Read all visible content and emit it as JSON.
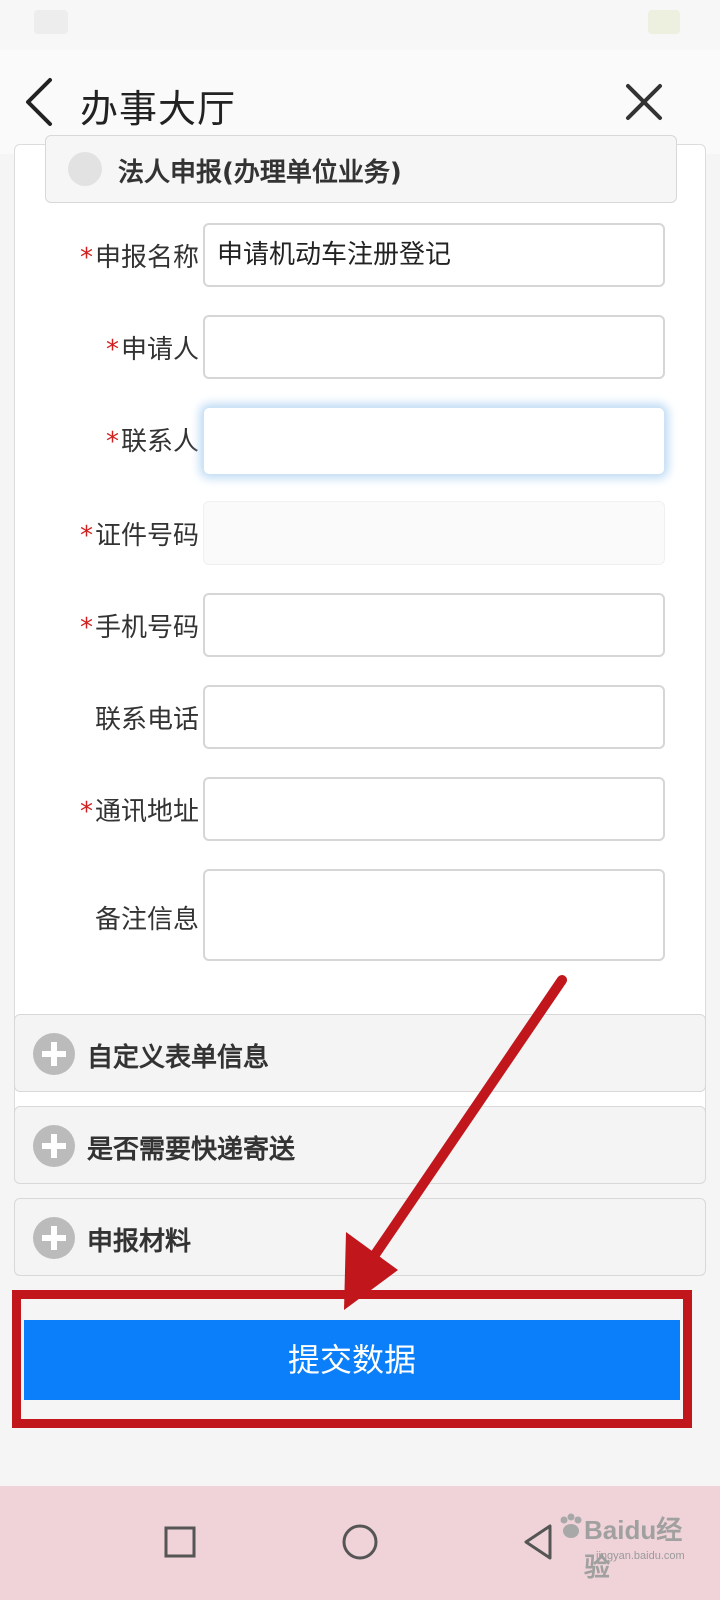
{
  "header": {
    "title": "办事大厅"
  },
  "form": {
    "applicant_type_option": "法人申报(办理单位业务)",
    "required_mark": "*",
    "fields": [
      {
        "label": "申报名称",
        "value": "申请机动车注册登记",
        "required": true
      },
      {
        "label": "申请人",
        "value": "",
        "required": true
      },
      {
        "label": "联系人",
        "value": "",
        "required": true
      },
      {
        "label": "证件号码",
        "value": "",
        "required": true
      },
      {
        "label": "手机号码",
        "value": "",
        "required": true
      },
      {
        "label": "联系电话",
        "value": "",
        "required": false
      },
      {
        "label": "通讯地址",
        "value": "",
        "required": true
      },
      {
        "label": "备注信息",
        "value": "",
        "required": false
      }
    ]
  },
  "sections": [
    {
      "label": "自定义表单信息"
    },
    {
      "label": "是否需要快递寄送"
    },
    {
      "label": "申报材料"
    }
  ],
  "submit": {
    "label": "提交数据"
  },
  "annotation": {
    "color": "#c0161c"
  },
  "watermark": {
    "main": "Baidu经验",
    "sub": "jingyan.baidu.com"
  },
  "colors": {
    "primary_button": "#0b7ef9",
    "required_star": "#d12020",
    "nav_bar": "#efd3d8"
  }
}
